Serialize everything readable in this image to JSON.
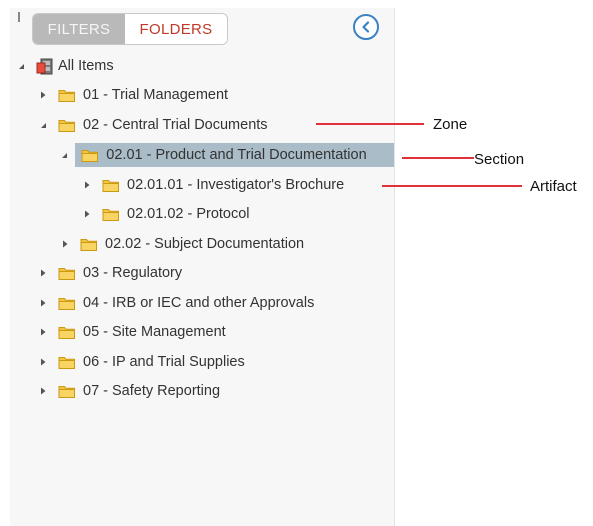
{
  "tabs": {
    "filters": "FILTERS",
    "folders": "FOLDERS"
  },
  "tree": {
    "root": "All Items",
    "items": [
      {
        "label": "01 - Trial Management",
        "expanded": false
      },
      {
        "label": "02 - Central Trial Documents",
        "expanded": true
      },
      {
        "label": "02.01 - Product and Trial Documentation",
        "expanded": true,
        "selected": true
      },
      {
        "label": "02.01.01 - Investigator's Brochure",
        "expanded": false
      },
      {
        "label": "02.01.02 - Protocol",
        "expanded": false
      },
      {
        "label": "02.02 - Subject Documentation",
        "expanded": false
      },
      {
        "label": "03 - Regulatory",
        "expanded": false
      },
      {
        "label": "04 - IRB or IEC and other Approvals",
        "expanded": false
      },
      {
        "label": "05 - Site Management",
        "expanded": false
      },
      {
        "label": "06 - IP and Trial Supplies",
        "expanded": false
      },
      {
        "label": "07 - Safety Reporting",
        "expanded": false
      }
    ]
  },
  "annotations": {
    "zone": "Zone",
    "section": "Section",
    "artifact": "Artifact"
  },
  "colors": {
    "accent": "#c0392b",
    "selection": "#a9bcc7",
    "annotation_line": "#e0303a",
    "folder": "#f2c12e"
  }
}
